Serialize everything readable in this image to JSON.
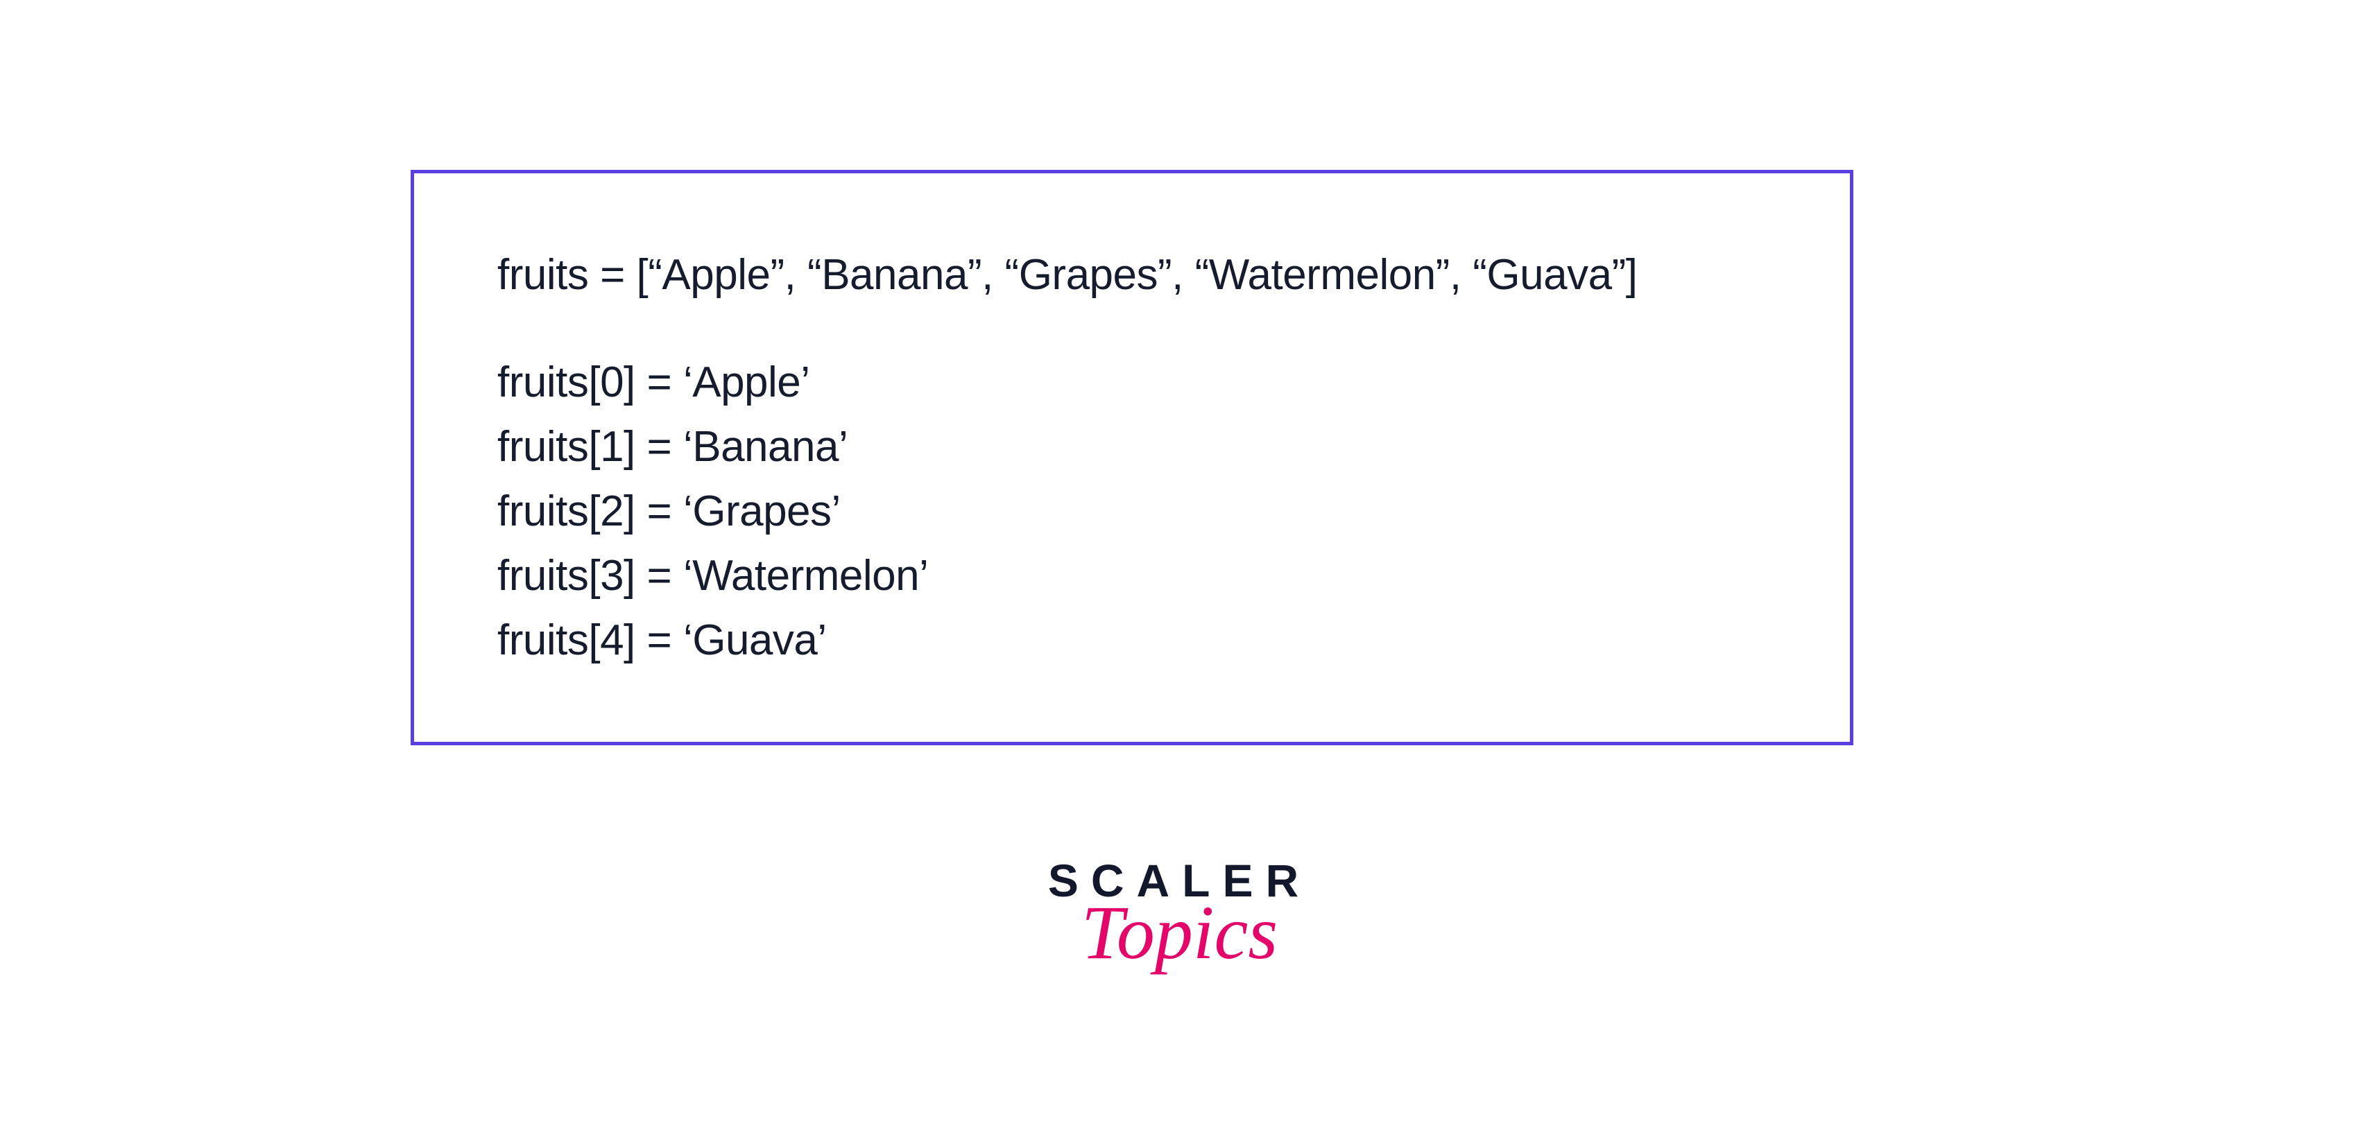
{
  "code": {
    "declaration": "fruits = [“Apple”, “Banana”, “Grapes”, “Watermelon”, “Guava”]",
    "lines": [
      "fruits[0] = ‘Apple’",
      "fruits[1] = ‘Banana’",
      "fruits[2] = ‘Grapes’",
      "fruits[3] = ‘Watermelon’",
      "fruits[4] = ‘Guava’"
    ]
  },
  "logo": {
    "main": "SCALER",
    "sub": "Topics"
  }
}
